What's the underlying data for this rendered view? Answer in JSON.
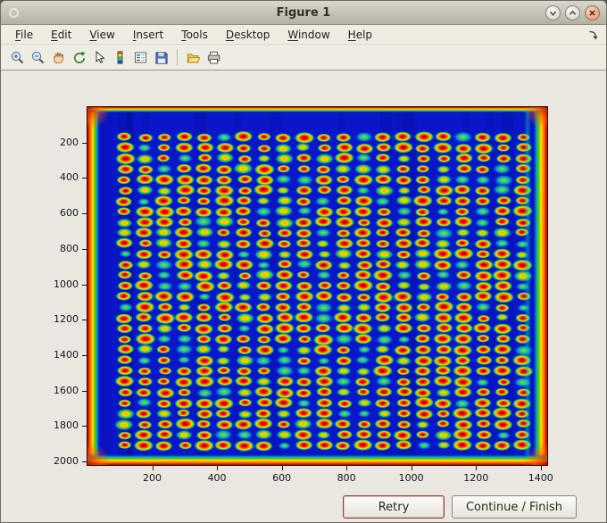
{
  "window": {
    "title": "Figure 1",
    "controls": [
      {
        "name": "minimize",
        "glyph": "chevron-down"
      },
      {
        "name": "maximize",
        "glyph": "chevron-up"
      },
      {
        "name": "close",
        "glyph": "cross"
      }
    ]
  },
  "menubar": {
    "items": [
      "File",
      "Edit",
      "View",
      "Insert",
      "Tools",
      "Desktop",
      "Window",
      "Help"
    ]
  },
  "toolbar": {
    "groups": [
      [
        "zoom-in",
        "zoom-out",
        "pan",
        "rotate-3d",
        "data-cursor",
        "insert-colorbar",
        "insert-legend",
        "save"
      ],
      [
        "open",
        "print"
      ]
    ]
  },
  "figure": {
    "buttons": [
      {
        "id": "retry",
        "label": "Retry"
      },
      {
        "id": "continue",
        "label": "Continue / Finish"
      }
    ]
  },
  "chart_data": {
    "type": "heatmap",
    "title": "",
    "xlabel": "",
    "ylabel": "",
    "x_ticks": [
      200,
      400,
      600,
      800,
      1000,
      1200,
      1400
    ],
    "y_ticks": [
      200,
      400,
      600,
      800,
      1000,
      1200,
      1400,
      1600,
      1800,
      2000
    ],
    "xlim": [
      0,
      1420
    ],
    "ylim": [
      0,
      2020
    ],
    "y_axis_direction": "reverse",
    "colormap": "jet",
    "content_description": "Microarray scan image: regular grid of hot (red/orange-core) spots on a deep blue background, with saturated red/orange/yellow/green bands along all four image edges and bright red corners.",
    "background_color": "#0a16c8",
    "spot_grid": {
      "cols": 21,
      "rows": 30,
      "x_start": 115,
      "x_step": 61.5,
      "y_start": 170,
      "y_step": 60
    },
    "edge_palette": [
      "#b40000",
      "#ff3c00",
      "#ff9e00",
      "#ffe100",
      "#46d200",
      "#00b4d2"
    ]
  }
}
